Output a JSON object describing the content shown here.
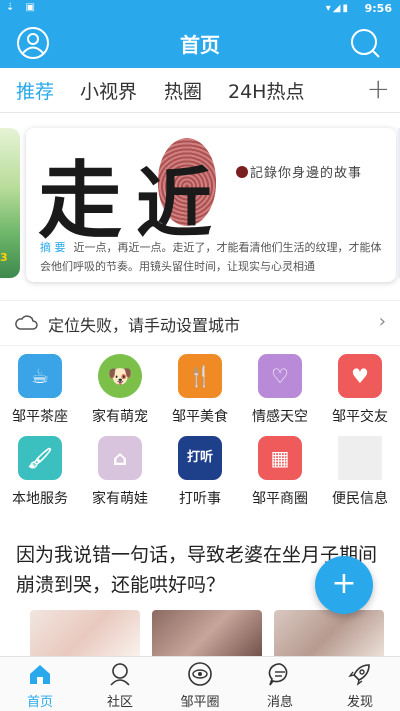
{
  "status_bar": {
    "time": "9:56",
    "left_icons": "⇣ ▣"
  },
  "header": {
    "title": "首页",
    "left_icon": "user-icon",
    "right_icon": "search-icon"
  },
  "tabs": [
    {
      "label": "推荐",
      "active": true
    },
    {
      "label": "小视界",
      "active": false
    },
    {
      "label": "热圈",
      "active": false
    },
    {
      "label": "24H热点",
      "active": false
    }
  ],
  "tabs_add": "+",
  "banner": {
    "left_card_text": "3",
    "big_text_1": "走",
    "big_text_2": "近",
    "slogan": "記錄你身邊的故事",
    "summary_tag": "摘 要",
    "summary": "近一点，再近一点。走近了，才能看清他们生活的纹理，才能体会他们呼吸的节奏。用镜头留住时间，让现实与心灵相通"
  },
  "location": {
    "text": "定位失败，请手动设置城市",
    "chevron": "›"
  },
  "grid": [
    {
      "label": "邹平茶座",
      "icon": "tea-cup-icon",
      "color": "#3aa4e6",
      "glyph": "☕"
    },
    {
      "label": "家有萌宠",
      "icon": "dog-icon",
      "color": "#7cc04a",
      "glyph": "🐶"
    },
    {
      "label": "邹平美食",
      "icon": "food-icon",
      "color": "#f08a24",
      "glyph": "🍴"
    },
    {
      "label": "情感天空",
      "icon": "heart-face-icon",
      "color": "#b98ad8",
      "glyph": "♡"
    },
    {
      "label": "邹平交友",
      "icon": "heart-icon",
      "color": "#ef5a5a",
      "glyph": "♥"
    },
    {
      "label": "本地服务",
      "icon": "paint-roller-icon",
      "color": "#3bbfbf",
      "glyph": "🖌"
    },
    {
      "label": "家有萌娃",
      "icon": "home-icon",
      "color": "#d9c4dd",
      "glyph": "⌂"
    },
    {
      "label": "打听事",
      "icon": "magnifier-ask-icon",
      "color": "#1e3f8a",
      "glyph": "打听"
    },
    {
      "label": "邹平商圈",
      "icon": "building-icon",
      "color": "#ef5a5a",
      "glyph": "▦"
    },
    {
      "label": "便民信息",
      "icon": "placeholder-icon",
      "color": "#eeeeee",
      "glyph": ""
    }
  ],
  "article": {
    "title": "因为我说错一句话，导致老婆在坐月子期间崩溃到哭，还能哄好吗？"
  },
  "fab": "+",
  "bottom_nav": [
    {
      "label": "首页",
      "icon": "home-icon",
      "active": true
    },
    {
      "label": "社区",
      "icon": "community-icon",
      "active": false
    },
    {
      "label": "邹平圈",
      "icon": "eye-circle-icon",
      "active": false
    },
    {
      "label": "消息",
      "icon": "message-icon",
      "active": false
    },
    {
      "label": "发现",
      "icon": "rocket-icon",
      "active": false
    }
  ],
  "colors": {
    "primary": "#29a9ec"
  }
}
